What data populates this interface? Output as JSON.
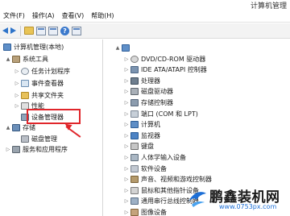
{
  "window": {
    "title": "计算机管理"
  },
  "menu": [
    "文件(F)",
    "操作(A)",
    "查看(V)",
    "帮助(H)"
  ],
  "toolbar": {
    "back": "back-arrow-icon",
    "forward": "forward-arrow-icon",
    "icons": [
      "up-folder-icon",
      "console-tree-icon",
      "properties-icon",
      "help-icon",
      "view-icon"
    ],
    "help_glyph": "?"
  },
  "left_tree": [
    {
      "label": "计算机管理(本地)",
      "icon": "computer-icon",
      "expander": "",
      "level": 0
    },
    {
      "label": "系统工具",
      "icon": "tools-icon",
      "expander": "▲",
      "level": 1
    },
    {
      "label": "任务计划程序",
      "icon": "clock-icon",
      "expander": "▷",
      "level": 2
    },
    {
      "label": "事件查看器",
      "icon": "event-log-icon",
      "expander": "▷",
      "level": 2
    },
    {
      "label": "共享文件夹",
      "icon": "folder-icon",
      "expander": "▷",
      "level": 2
    },
    {
      "label": "性能",
      "icon": "performance-icon",
      "expander": "▷",
      "level": 2
    },
    {
      "label": "设备管理器",
      "icon": "device-manager-icon",
      "expander": "",
      "level": 2
    },
    {
      "label": "存储",
      "icon": "storage-icon",
      "expander": "▲",
      "level": 1
    },
    {
      "label": "磁盘管理",
      "icon": "disk-icon",
      "expander": "",
      "level": 2
    },
    {
      "label": "服务和应用程序",
      "icon": "services-icon",
      "expander": "▷",
      "level": 1
    }
  ],
  "right_tree": {
    "root": {
      "label": "",
      "icon": "computer-icon",
      "expander": "▲"
    },
    "items": [
      {
        "label": "DVD/CD-ROM 驱动器",
        "icon": "dvd-icon"
      },
      {
        "label": "IDE ATA/ATAPI 控制器",
        "icon": "ide-icon"
      },
      {
        "label": "处理器",
        "icon": "cpu-icon"
      },
      {
        "label": "磁盘驱动器",
        "icon": "hdd-icon"
      },
      {
        "label": "存储控制器",
        "icon": "storage-controller-icon"
      },
      {
        "label": "端口 (COM 和 LPT)",
        "icon": "port-icon"
      },
      {
        "label": "计算机",
        "icon": "computer-icon"
      },
      {
        "label": "监视器",
        "icon": "monitor-icon"
      },
      {
        "label": "键盘",
        "icon": "keyboard-icon"
      },
      {
        "label": "人体学输入设备",
        "icon": "hid-icon"
      },
      {
        "label": "软件设备",
        "icon": "software-device-icon"
      },
      {
        "label": "声音、视频和游戏控制器",
        "icon": "sound-icon"
      },
      {
        "label": "鼠标和其他指针设备",
        "icon": "mouse-icon"
      },
      {
        "label": "通用串行总线控制器",
        "icon": "usb-icon"
      },
      {
        "label": "图像设备",
        "icon": "imaging-icon"
      }
    ],
    "expander": "▷"
  },
  "annotation": {
    "box_color": "#e0262b",
    "arrow_color": "#e0262b"
  },
  "watermark": {
    "title": "鹏鑫装机网",
    "url": "www.0753px.com",
    "logo": "bird-logo-icon"
  },
  "colors": {
    "link_blue": "#1d6fd6",
    "highlight_red": "#e0262b"
  }
}
